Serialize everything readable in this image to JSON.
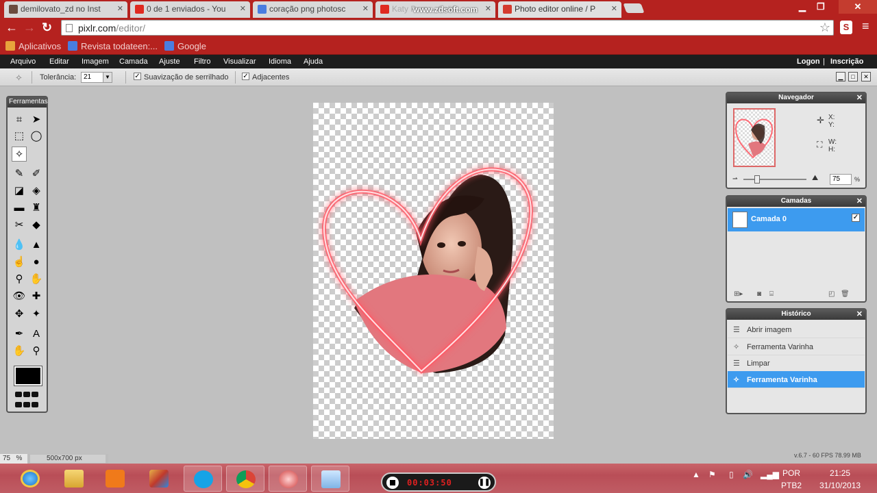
{
  "browser": {
    "tabs": [
      {
        "label": "demilovato_zd no Inst",
        "icon": "instagram-icon",
        "color": "#6b4b3e"
      },
      {
        "label": "0 de 1 enviados - You",
        "icon": "youtube-icon",
        "color": "#e02a20"
      },
      {
        "label": "coração png photosc",
        "icon": "google-icon",
        "color": "#4a7de0"
      },
      {
        "label": "Katy Perry - Califo",
        "icon": "youtube-icon",
        "color": "#e02a20"
      },
      {
        "label": "Photo editor online / P",
        "icon": "pixlr-icon",
        "color": "#d43b2f"
      }
    ],
    "watermark": "www.zdsoft.com",
    "url_host": "pixlr.com",
    "url_path": "/editor/",
    "ext_label": "S",
    "bookmarks": [
      {
        "label": "Aplicativos",
        "icon": "apps-icon",
        "color": "#e8a33c"
      },
      {
        "label": "Revista todateen:...",
        "icon": "google-icon",
        "color": "#4a7de0"
      },
      {
        "label": "Google",
        "icon": "google-icon",
        "color": "#4a7de0"
      }
    ],
    "accent": "#b5221f"
  },
  "menubar": {
    "items": [
      "Arquivo",
      "Editar",
      "Imagem",
      "Camada",
      "Ajuste",
      "Filtro",
      "Visualizar",
      "Idioma",
      "Ajuda"
    ],
    "login": "Logon",
    "separator": "|",
    "signup": "Inscrição"
  },
  "options": {
    "tolerance_label": "Tolerância:",
    "tolerance_value": "21",
    "antialias_label": "Suavização de serrilhado",
    "antialias_checked": true,
    "contiguous_label": "Adjacentes",
    "contiguous_checked": true
  },
  "tools": {
    "title": "Ferramentas",
    "items": [
      {
        "name": "crop-icon",
        "glyph": "⌗"
      },
      {
        "name": "move-icon",
        "glyph": "➤"
      },
      {
        "name": "marquee-icon",
        "glyph": "⬚"
      },
      {
        "name": "lasso-icon",
        "glyph": "◯"
      },
      {
        "name": "magic-wand-icon",
        "glyph": "✧"
      },
      {
        "name": "pencil-icon",
        "glyph": "✎"
      },
      {
        "name": "brush-icon",
        "glyph": "✐"
      },
      {
        "name": "eraser-icon",
        "glyph": "◪"
      },
      {
        "name": "paint-bucket-icon",
        "glyph": "◈"
      },
      {
        "name": "gradient-icon",
        "glyph": "▬"
      },
      {
        "name": "clone-stamp-icon",
        "glyph": "♜"
      },
      {
        "name": "color-replace-icon",
        "glyph": "✂"
      },
      {
        "name": "drawing-icon",
        "glyph": "◆"
      },
      {
        "name": "blur-icon",
        "glyph": "💧"
      },
      {
        "name": "sharpen-icon",
        "glyph": "▲"
      },
      {
        "name": "smudge-icon",
        "glyph": "☝"
      },
      {
        "name": "sponge-icon",
        "glyph": "●"
      },
      {
        "name": "dodge-icon",
        "glyph": "⚲"
      },
      {
        "name": "burn-icon",
        "glyph": "✋"
      },
      {
        "name": "red-eye-icon",
        "glyph": "👁"
      },
      {
        "name": "spot-heal-icon",
        "glyph": "✚"
      },
      {
        "name": "bloat-icon",
        "glyph": "✥"
      },
      {
        "name": "pinch-icon",
        "glyph": "✦"
      },
      {
        "name": "color-picker-icon",
        "glyph": "✒"
      },
      {
        "name": "type-icon",
        "glyph": "A"
      },
      {
        "name": "hand-icon",
        "glyph": "✋"
      },
      {
        "name": "zoom-icon",
        "glyph": "⚲"
      }
    ],
    "selected": "magic-wand-icon",
    "foreground_color": "#000000"
  },
  "navigator": {
    "title": "Navegador",
    "x_label": "X:",
    "y_label": "Y:",
    "w_label": "W:",
    "h_label": "H:",
    "zoom": "75",
    "zoom_unit": "%",
    "zoom_level": 0.2
  },
  "layers": {
    "title": "Camadas",
    "items": [
      {
        "label": "Camada 0",
        "visible": true,
        "selected": true
      }
    ]
  },
  "history": {
    "title": "Histórico",
    "items": [
      {
        "label": "Abrir imagem",
        "active": false
      },
      {
        "label": "Ferramenta Varinha",
        "active": false
      },
      {
        "label": "Limpar",
        "active": false
      },
      {
        "label": "Ferramenta Varinha",
        "active": true
      }
    ]
  },
  "status": {
    "zoom": "75",
    "zoom_unit": "%",
    "dimensions": "500x700 px",
    "version": "v.6.7 - 60 FPS 78.99 MB"
  },
  "taskbar": {
    "recorder_time": "00:03:50",
    "language_top": "POR",
    "language_bottom": "PTB2",
    "time": "21:25",
    "date": "31/10/2013"
  }
}
